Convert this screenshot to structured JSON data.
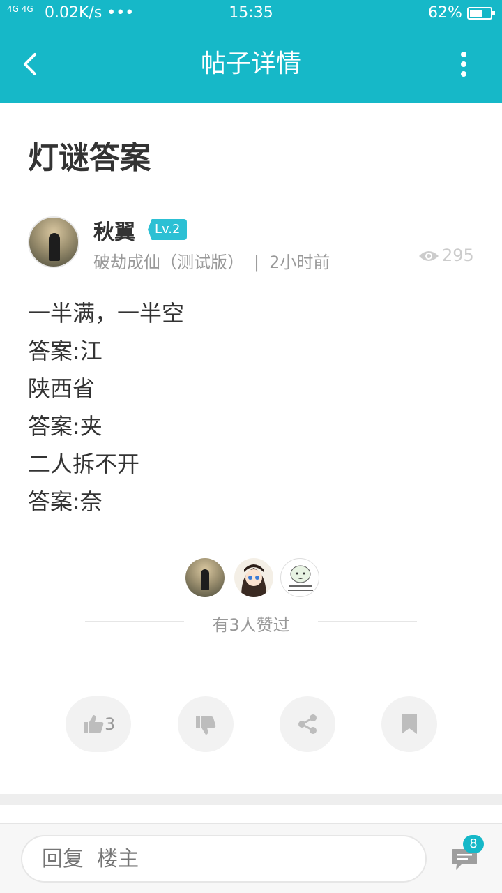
{
  "status_bar": {
    "signal": "4G 4G",
    "network_speed": "0.02K/s •••",
    "time": "15:35",
    "battery_pct": "62%",
    "battery_level": 0.62
  },
  "app_bar": {
    "title": "帖子详情"
  },
  "post": {
    "title": "灯谜答案",
    "author": {
      "name": "秋翼",
      "level": "Lv.2"
    },
    "forum": "破劫成仙（测试版）",
    "separator": "|",
    "time": "2小时前",
    "views": "295",
    "body": [
      "一半满，一半空",
      "答案:江",
      "陕西省",
      "答案:夹",
      "二人拆不开",
      "答案:奈"
    ]
  },
  "likes": {
    "summary": "有3人赞过"
  },
  "actions": {
    "like_count": "3"
  },
  "reply": {
    "placeholder": "回复  楼主",
    "comment_count": "8"
  },
  "colors": {
    "accent": "#16b8c8",
    "badge": "#2cc0d4"
  }
}
